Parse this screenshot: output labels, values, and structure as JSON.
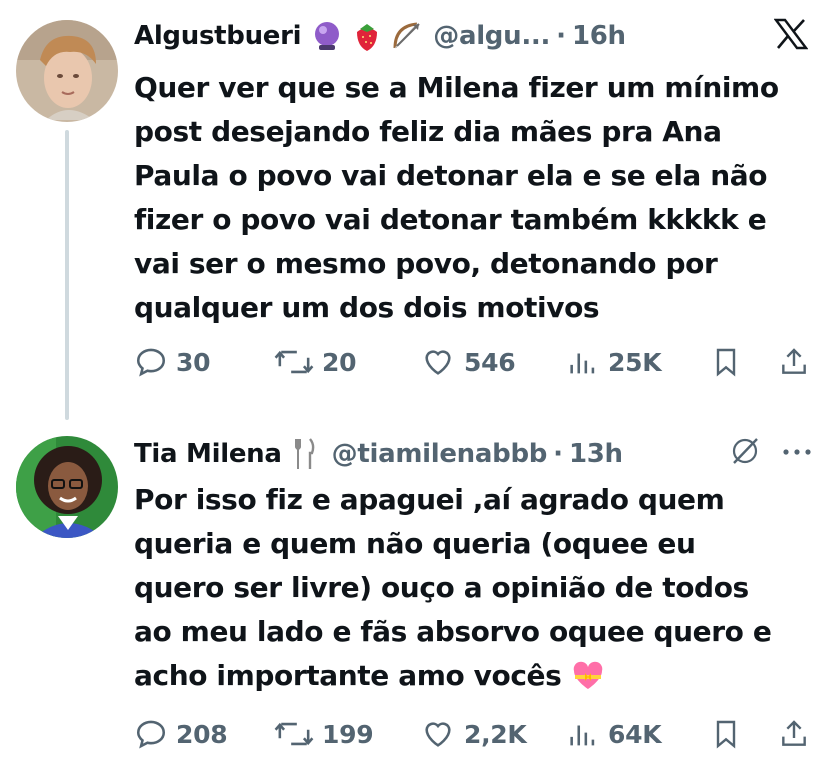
{
  "tweets": [
    {
      "display_name": "Algustbueri",
      "handle": "@algu...",
      "time": "16h",
      "text": "Quer ver que se a Milena fizer um mínimo post desejando feliz dia mães pra Ana Paula o povo vai detonar ela e se ela não fizer o povo vai detonar também kkkkk e vai ser o mesmo povo, detonando por qualquer um dos dois motivos",
      "lines": [
        "Quer ver que se a Milena fizer um mínimo",
        "post desejando feliz dia mães pra Ana",
        "Paula o povo vai detonar ela e se ela não",
        "fizer o povo vai detonar também kkkkk e",
        "vai ser o mesmo povo, detonando por",
        "qualquer um dos dois motivos"
      ],
      "name_emojis": [
        "crystal-ball-icon",
        "strawberry-icon",
        "bow-and-arrow-icon"
      ],
      "corner_icon": "x-logo-icon",
      "stats": {
        "replies": "30",
        "reposts": "20",
        "likes": "546",
        "views": "25K"
      }
    },
    {
      "display_name": "Tia Milena",
      "handle": "@tiamilenabbb",
      "time": "13h",
      "text": "Por isso fiz e apaguei ,aí agrado quem queria e quem não queria (oquee eu quero ser livre) ouço a opinião de todos ao meu lado e fãs absorvo oquee quero e acho importante amo vocês",
      "lines": [
        "Por isso fiz e apaguei ,aí agrado quem",
        "queria e quem não queria (oquee eu",
        "quero ser livre) ouço a opinião de todos",
        "ao meu lado e fãs absorvo oquee quero e",
        "acho importante amo vocês"
      ],
      "name_emojis": [
        "fork-and-knife-icon"
      ],
      "trailing_emoji": "heart-with-ribbon-icon",
      "corner_icons": [
        "grok-icon",
        "more-icon"
      ],
      "stats": {
        "replies": "208",
        "reposts": "199",
        "likes": "2,2K",
        "views": "64K"
      }
    }
  ],
  "colors": {
    "text": "#0f1419",
    "secondary": "#536471",
    "thread_line": "#cfd9de",
    "background": "#ffffff"
  }
}
